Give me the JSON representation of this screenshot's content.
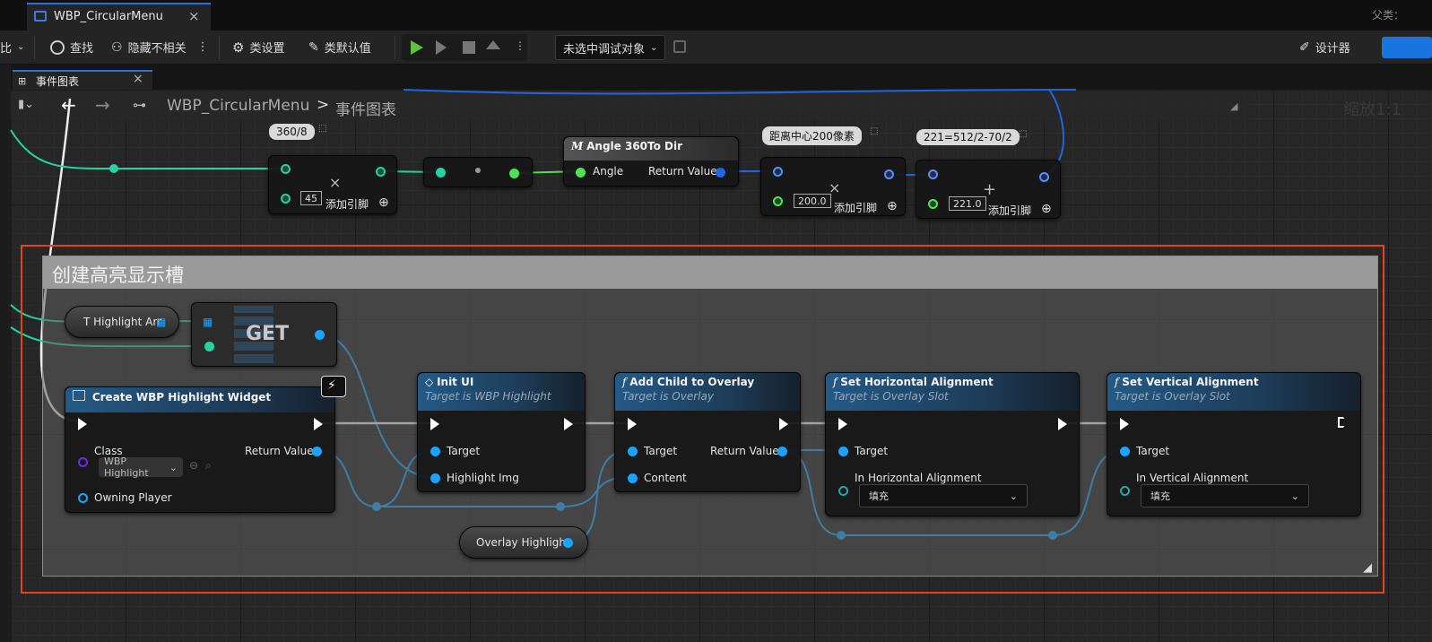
{
  "window": {
    "tab_title": "WBP_CircularMenu",
    "right_label": "父类：",
    "zoom_label": "缩放1:1"
  },
  "toolbar": {
    "left_partial": "比",
    "find": "查找",
    "hide_unrelated": "隐藏不相关",
    "class_settings": "类设置",
    "class_defaults": "类默认值",
    "debug_target": "未选中调试对象",
    "designer": "设计器"
  },
  "graph_tab": {
    "label": "事件图表"
  },
  "breadcrumb": {
    "root": "WBP_CircularMenu",
    "separator": ">",
    "current": "事件图表"
  },
  "comment": {
    "title": "创建高亮显示槽"
  },
  "top_row": {
    "div_comment": "360/8",
    "div_value": "45",
    "add_pin": "添加引脚",
    "angle_node": {
      "title": "Angle 360To Dir",
      "in": "Angle",
      "out": "Return Value"
    },
    "mul_comment": "距离中心200像素",
    "mul_value": "200.0",
    "add_comment": "221=512/2-70/2",
    "add_value": "221.0"
  },
  "nodes": {
    "t_highlight": "T Highlight Arr",
    "get": "GET",
    "create_widget": {
      "title": "Create WBP Highlight Widget",
      "class_label": "Class",
      "class_value": "WBP Highlight",
      "return": "Return Value",
      "owning": "Owning Player"
    },
    "init_ui": {
      "title": "Init UI",
      "sub": "Target is WBP Highlight",
      "target": "Target",
      "img": "Highlight Img"
    },
    "add_child": {
      "title": "Add Child to Overlay",
      "sub": "Target is Overlay",
      "target": "Target",
      "content": "Content",
      "return": "Return Value"
    },
    "set_h": {
      "title": "Set Horizontal Alignment",
      "sub": "Target is Overlay Slot",
      "target": "Target",
      "param": "In Horizontal Alignment",
      "value": "填充"
    },
    "set_v": {
      "title": "Set Vertical Alignment",
      "sub": "Target is Overlay Slot",
      "target": "Target",
      "param": "In Vertical Alignment",
      "value": "填充"
    },
    "overlay": "Overlay Highlight"
  },
  "colors": {
    "exec": "#ffffff",
    "object_wire": "#1aa3ff",
    "int_wire": "#25d2a0",
    "float_wire": "#4fe05a",
    "vector_wire": "#1f66e0",
    "comment_border": "#e0451d"
  }
}
